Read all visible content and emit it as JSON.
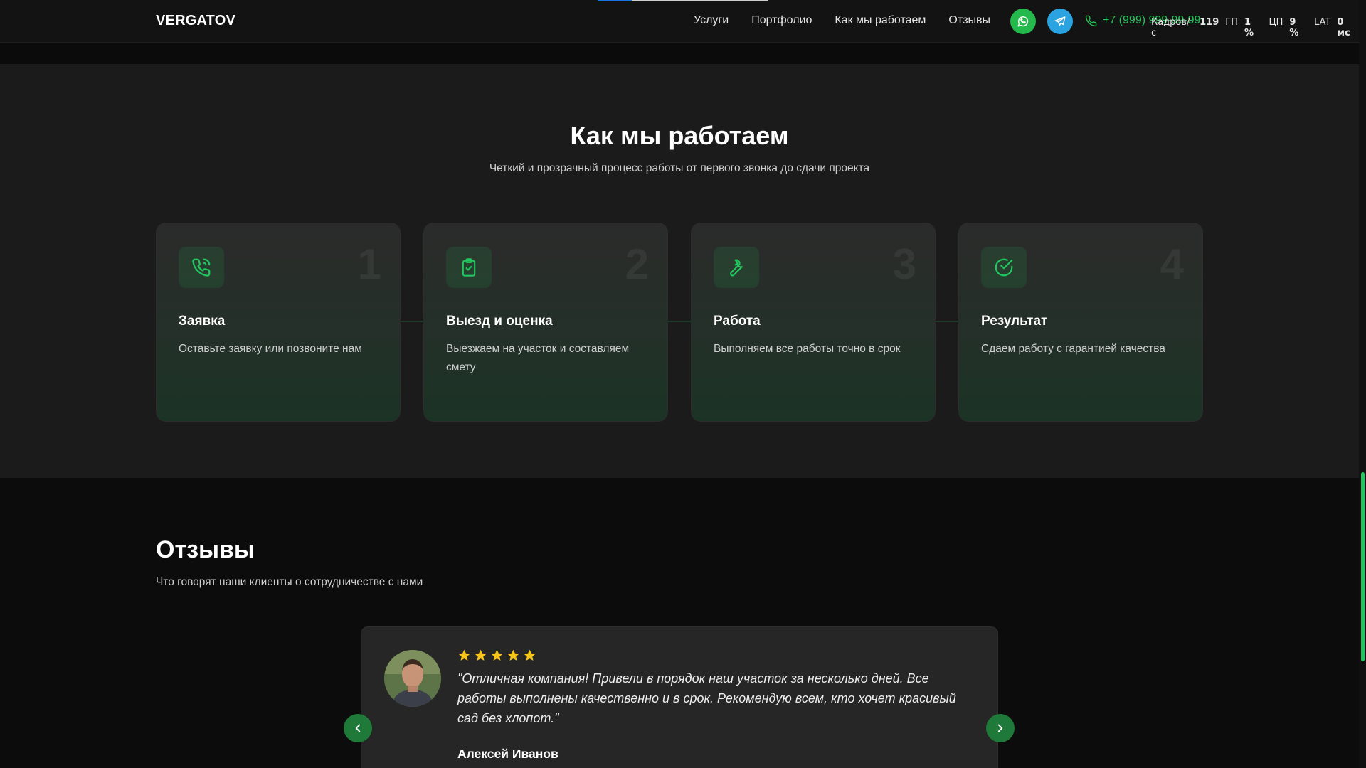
{
  "header": {
    "logo": "VERGATOV",
    "nav": [
      "Услуги",
      "Портфолио",
      "Как мы работаем",
      "Отзывы"
    ],
    "phone": "+7 (999) 999-99-99",
    "overlay": {
      "fps_label": "Кадров/с",
      "fps_value": "119",
      "gpu_label": "ГП",
      "gpu_value": "1 %",
      "cpu_label": "ЦП",
      "cpu_value": "9 %",
      "lat_label": "LAT",
      "lat_value": "0 мс"
    }
  },
  "how": {
    "title": "Как мы работаем",
    "subtitle": "Четкий и прозрачный процесс работы от первого звонка до сдачи проекта",
    "steps": [
      {
        "number": "1",
        "title": "Заявка",
        "text": "Оставьте заявку или позвоните нам",
        "icon": "phone-call-icon"
      },
      {
        "number": "2",
        "title": "Выезд и оценка",
        "text": "Выезжаем на участок и составляем смету",
        "icon": "clipboard-check-icon"
      },
      {
        "number": "3",
        "title": "Работа",
        "text": "Выполняем все работы точно в срок",
        "icon": "wrench-icon"
      },
      {
        "number": "4",
        "title": "Результат",
        "text": "Сдаем работу с гарантией качества",
        "icon": "check-circle-icon"
      }
    ]
  },
  "reviews": {
    "title": "Отзывы",
    "subtitle": "Что говорят наши клиенты о сотрудничестве с нами",
    "current": {
      "rating": 5,
      "quote": "\"Отличная компания! Привели в порядок наш участок за несколько дней. Все работы выполнены качественно и в срок. Рекомендую всем, кто хочет красивый сад без хлопот.\"",
      "author": "Алексей Иванов"
    }
  },
  "colors": {
    "accent": "#22c55e",
    "whatsapp": "#25b84c",
    "telegram": "#2aa3e0",
    "star": "#f5c518"
  }
}
